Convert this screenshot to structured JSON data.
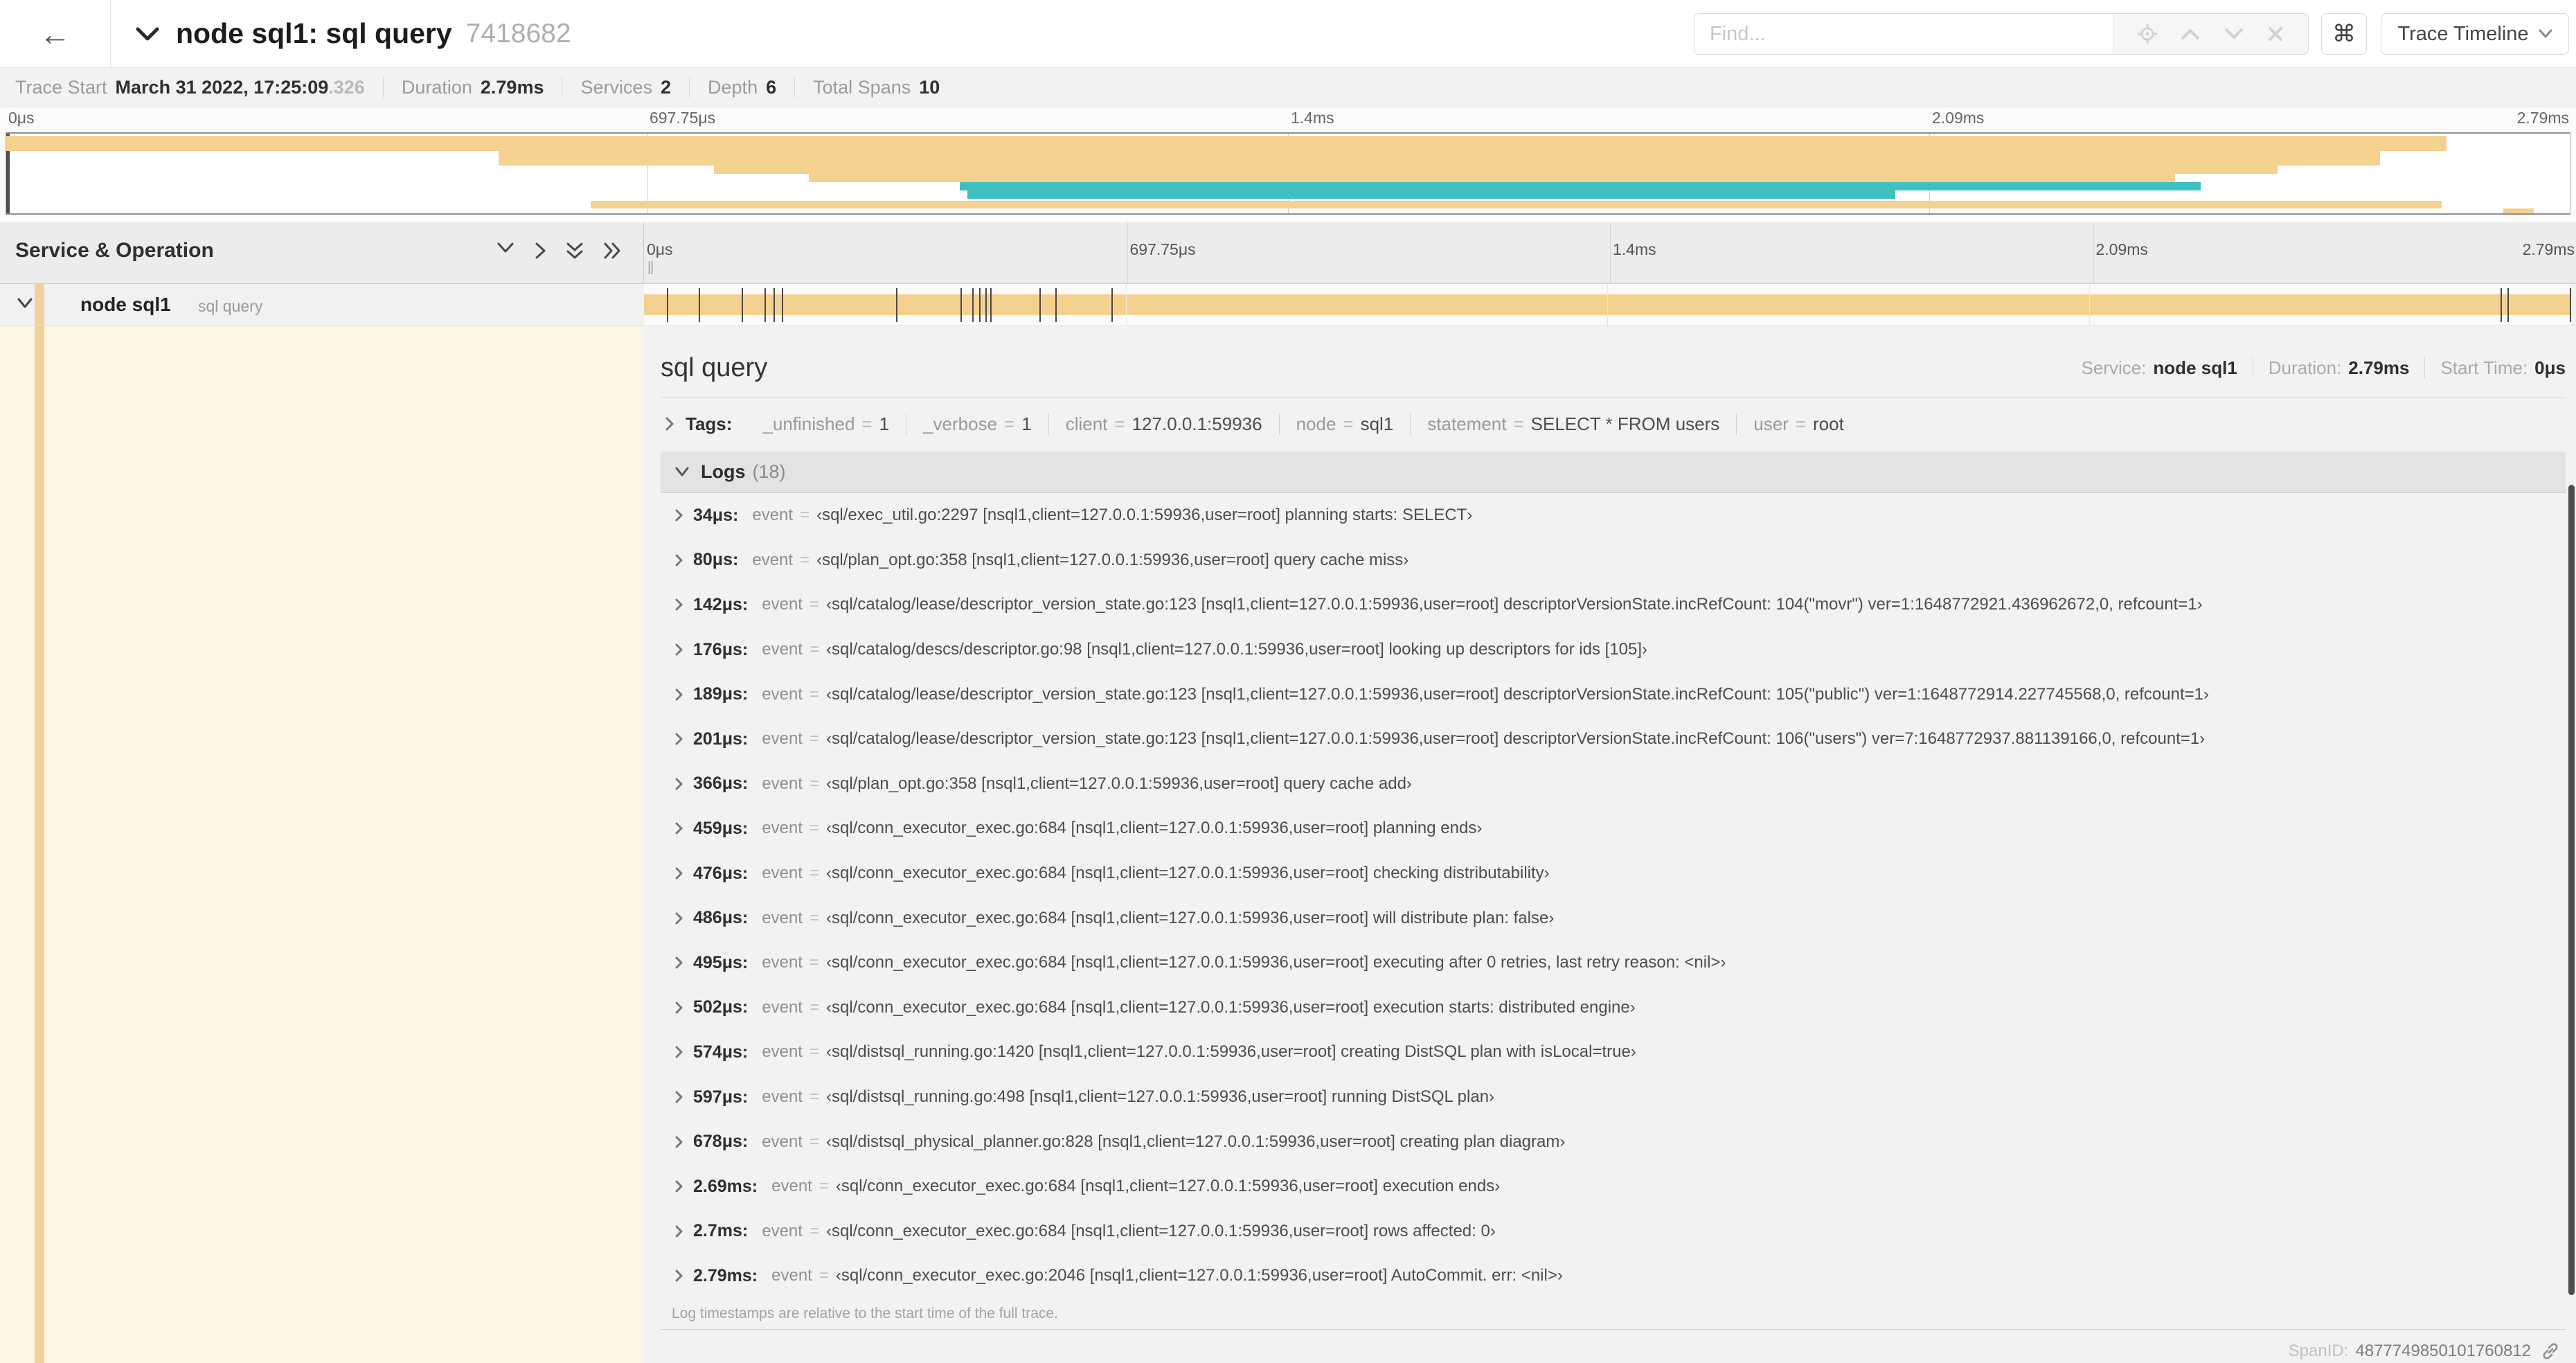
{
  "header": {
    "back_icon": "←",
    "title": "node sql1: sql query",
    "trace_id": "7418682",
    "find_placeholder": "Find...",
    "kbd_icon": "⌘",
    "view_selector": "Trace Timeline"
  },
  "summary": {
    "trace_start_label": "Trace Start",
    "trace_start": "March 31 2022, 17:25:09",
    "trace_start_frac": ".326",
    "duration_label": "Duration",
    "duration": "2.79ms",
    "services_label": "Services",
    "services": "2",
    "depth_label": "Depth",
    "depth": "6",
    "total_spans_label": "Total Spans",
    "total_spans": "10"
  },
  "timeline": {
    "ticks": [
      "0μs",
      "697.75μs",
      "1.4ms",
      "2.09ms",
      "2.79ms"
    ],
    "duration_us": 2790
  },
  "columns": {
    "left_header": "Service & Operation"
  },
  "span_row": {
    "service": "node sql1",
    "operation": "sql query"
  },
  "minimap": {
    "bars": [
      {
        "c": "beige",
        "t": 3,
        "h": 22,
        "l": 0,
        "w": 95.2
      },
      {
        "c": "beige",
        "t": 25,
        "h": 21,
        "l": 19.2,
        "w": 73.4
      },
      {
        "c": "beige",
        "t": 46,
        "h": 12,
        "l": 27.6,
        "w": 61.0
      },
      {
        "c": "beige",
        "t": 58,
        "h": 12,
        "l": 31.3,
        "w": 53.3
      },
      {
        "c": "teal",
        "t": 70,
        "h": 12,
        "l": 37.2,
        "w": 48.4
      },
      {
        "c": "teal",
        "t": 82,
        "h": 12,
        "l": 37.5,
        "w": 36.2
      },
      {
        "c": "beige",
        "t": 97,
        "h": 11,
        "l": 22.8,
        "w": 72.2
      },
      {
        "c": "beige",
        "t": 108,
        "h": 7,
        "l": 97.4,
        "w": 1.2
      }
    ]
  },
  "detail": {
    "operation": "sql query",
    "service_label": "Service:",
    "service": "node sql1",
    "duration_label": "Duration:",
    "duration": "2.79ms",
    "start_label": "Start Time:",
    "start": "0μs",
    "tags_label": "Tags:",
    "eq": "=",
    "tags": [
      {
        "key": "_unfinished",
        "value": "1"
      },
      {
        "key": "_verbose",
        "value": "1"
      },
      {
        "key": "client",
        "value": "127.0.0.1:59936"
      },
      {
        "key": "node",
        "value": "sql1"
      },
      {
        "key": "statement",
        "value": "SELECT * FROM users"
      },
      {
        "key": "user",
        "value": "root"
      }
    ],
    "logs_label": "Logs",
    "logs_count": "(18)",
    "logs": [
      {
        "time": "34μs",
        "us": 34,
        "field": "event",
        "value": "‹sql/exec_util.go:2297 [nsql1,client=127.0.0.1:59936,user=root] planning starts: SELECT›"
      },
      {
        "time": "80μs",
        "us": 80,
        "field": "event",
        "value": "‹sql/plan_opt.go:358 [nsql1,client=127.0.0.1:59936,user=root] query cache miss›"
      },
      {
        "time": "142μs",
        "us": 142,
        "field": "event",
        "value": "‹sql/catalog/lease/descriptor_version_state.go:123 [nsql1,client=127.0.0.1:59936,user=root] descriptorVersionState.incRefCount: 104(\"movr\") ver=1:1648772921.436962672,0, refcount=1›"
      },
      {
        "time": "176μs",
        "us": 176,
        "field": "event",
        "value": "‹sql/catalog/descs/descriptor.go:98 [nsql1,client=127.0.0.1:59936,user=root] looking up descriptors for ids [105]›"
      },
      {
        "time": "189μs",
        "us": 189,
        "field": "event",
        "value": "‹sql/catalog/lease/descriptor_version_state.go:123 [nsql1,client=127.0.0.1:59936,user=root] descriptorVersionState.incRefCount: 105(\"public\") ver=1:1648772914.227745568,0, refcount=1›"
      },
      {
        "time": "201μs",
        "us": 201,
        "field": "event",
        "value": "‹sql/catalog/lease/descriptor_version_state.go:123 [nsql1,client=127.0.0.1:59936,user=root] descriptorVersionState.incRefCount: 106(\"users\") ver=7:1648772937.881139166,0, refcount=1›"
      },
      {
        "time": "366μs",
        "us": 366,
        "field": "event",
        "value": "‹sql/plan_opt.go:358 [nsql1,client=127.0.0.1:59936,user=root] query cache add›"
      },
      {
        "time": "459μs",
        "us": 459,
        "field": "event",
        "value": "‹sql/conn_executor_exec.go:684 [nsql1,client=127.0.0.1:59936,user=root] planning ends›"
      },
      {
        "time": "476μs",
        "us": 476,
        "field": "event",
        "value": "‹sql/conn_executor_exec.go:684 [nsql1,client=127.0.0.1:59936,user=root] checking distributability›"
      },
      {
        "time": "486μs",
        "us": 486,
        "field": "event",
        "value": "‹sql/conn_executor_exec.go:684 [nsql1,client=127.0.0.1:59936,user=root] will distribute plan: false›"
      },
      {
        "time": "495μs",
        "us": 495,
        "field": "event",
        "value": "‹sql/conn_executor_exec.go:684 [nsql1,client=127.0.0.1:59936,user=root] executing after 0 retries, last retry reason: <nil>›"
      },
      {
        "time": "502μs",
        "us": 502,
        "field": "event",
        "value": "‹sql/conn_executor_exec.go:684 [nsql1,client=127.0.0.1:59936,user=root] execution starts: distributed engine›"
      },
      {
        "time": "574μs",
        "us": 574,
        "field": "event",
        "value": "‹sql/distsql_running.go:1420 [nsql1,client=127.0.0.1:59936,user=root] creating DistSQL plan with isLocal=true›"
      },
      {
        "time": "597μs",
        "us": 597,
        "field": "event",
        "value": "‹sql/distsql_running.go:498 [nsql1,client=127.0.0.1:59936,user=root] running DistSQL plan›"
      },
      {
        "time": "678μs",
        "us": 678,
        "field": "event",
        "value": "‹sql/distsql_physical_planner.go:828 [nsql1,client=127.0.0.1:59936,user=root] creating plan diagram›"
      },
      {
        "time": "2.69ms",
        "us": 2690,
        "field": "event",
        "value": "‹sql/conn_executor_exec.go:684 [nsql1,client=127.0.0.1:59936,user=root] execution ends›"
      },
      {
        "time": "2.7ms",
        "us": 2700,
        "field": "event",
        "value": "‹sql/conn_executor_exec.go:684 [nsql1,client=127.0.0.1:59936,user=root] rows affected: 0›"
      },
      {
        "time": "2.79ms",
        "us": 2790,
        "field": "event",
        "value": "‹sql/conn_executor_exec.go:2046 [nsql1,client=127.0.0.1:59936,user=root] AutoCommit. err: <nil>›"
      }
    ],
    "footer_note": "Log timestamps are relative to the start time of the full trace.",
    "span_id_label": "SpanID:",
    "span_id": "4877749850101760812"
  },
  "palette": {
    "beige": "#f5d190",
    "teal": "#3fc0c0",
    "stripe": "#f0d29c",
    "cream": "#fdf6e4"
  }
}
